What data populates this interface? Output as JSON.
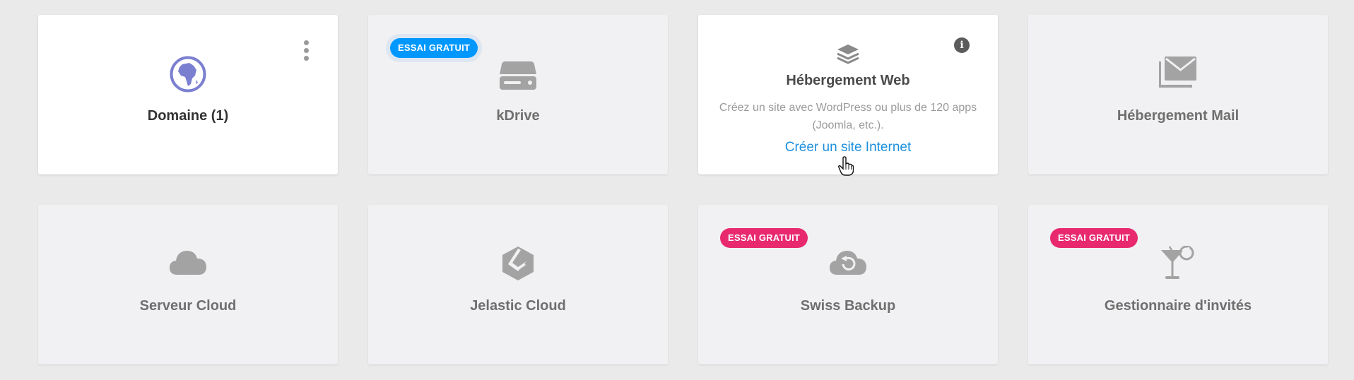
{
  "products": [
    {
      "title": "Domaine (1)",
      "icon": "globe-africa-icon",
      "state": "active"
    },
    {
      "title": "kDrive",
      "icon": "drive-icon",
      "badge": "ESSAI GRATUIT",
      "badge_color": "#0098ff"
    },
    {
      "title": "Hébergement Web",
      "icon": "layers-icon",
      "description": "Créez un site avec WordPress ou plus de 120 apps (Joomla, etc.).",
      "link": "Créer un site Internet",
      "link_color": "#1b8fdd"
    },
    {
      "title": "Hébergement Mail",
      "icon": "mail-icon"
    },
    {
      "title": "Serveur Cloud",
      "icon": "cloud-icon"
    },
    {
      "title": "Jelastic Cloud",
      "icon": "jelastic-icon"
    },
    {
      "title": "Swiss Backup",
      "icon": "cloud-backup-icon",
      "badge": "ESSAI GRATUIT",
      "badge_color": "#e8296e"
    },
    {
      "title": "Gestionnaire d'invités",
      "icon": "cocktail-icon",
      "badge": "ESSAI GRATUIT",
      "badge_color": "#e8296e"
    }
  ],
  "colors": {
    "accent": "#1b8fdd",
    "globe": "#7b7fd0",
    "icon_grey": "#a3a3a3",
    "trial_blue": "#0098ff",
    "trial_pink": "#e8296e"
  }
}
